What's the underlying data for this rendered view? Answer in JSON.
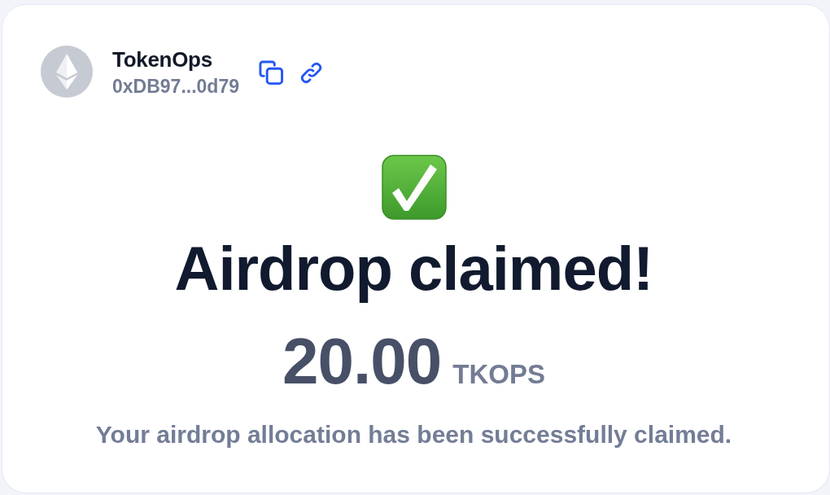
{
  "account": {
    "name": "TokenOps",
    "address": "0xDB97...0d79"
  },
  "status": {
    "kind": "success",
    "title": "Airdrop claimed!"
  },
  "amount": {
    "value": "20.00",
    "symbol": "TKOPS"
  },
  "message": "Your airdrop allocation has been successfully claimed."
}
